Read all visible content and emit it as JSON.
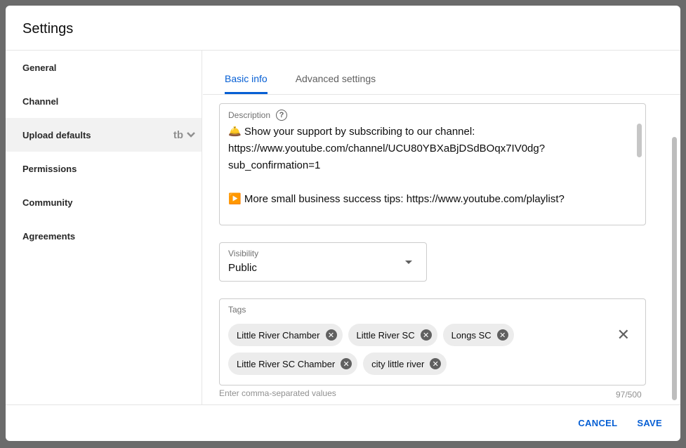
{
  "dialog": {
    "title": "Settings"
  },
  "sidebar": {
    "items": [
      {
        "label": "General"
      },
      {
        "label": "Channel"
      },
      {
        "label": "Upload defaults",
        "active": true
      },
      {
        "label": "Permissions"
      },
      {
        "label": "Community"
      },
      {
        "label": "Agreements"
      }
    ],
    "active_icons": [
      "tubebuddy-icon",
      "chevron-down-icon"
    ],
    "active_icon_text": "tb"
  },
  "tabs": [
    {
      "label": "Basic info",
      "active": true
    },
    {
      "label": "Advanced settings"
    }
  ],
  "description": {
    "label": "Description",
    "help_icon": "?",
    "lines": [
      "🛎️ Show your support by subscribing to our channel:",
      "https://www.youtube.com/channel/UCU80YBXaBjDSdBOqx7IV0dg?",
      "sub_confirmation=1",
      "",
      "▶️ More small business success tips: https://www.youtube.com/playlist?"
    ]
  },
  "visibility": {
    "label": "Visibility",
    "value": "Public"
  },
  "tags": {
    "label": "Tags",
    "items": [
      "Little River Chamber",
      "Little River SC",
      "Longs SC",
      "Little River SC Chamber",
      "city little river"
    ],
    "hint": "Enter comma-separated values",
    "count": "97/500",
    "chip_remove": "✕",
    "clear": "✕"
  },
  "footer": {
    "cancel": "CANCEL",
    "save": "SAVE"
  },
  "colors": {
    "accent": "#065fd4",
    "backdrop": "#6b6b6b"
  }
}
